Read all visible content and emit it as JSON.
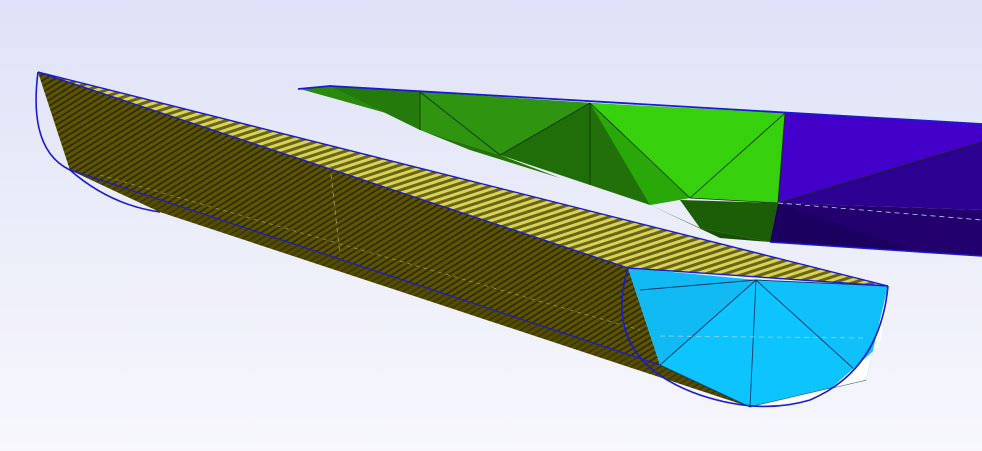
{
  "viewport": {
    "background_top": "#dfe2f8",
    "background_bottom": "#f7f7fd",
    "outline_color": "#1a1ad0"
  },
  "objects": [
    {
      "name": "dark-green-mesh-section",
      "color": "#237a0c"
    },
    {
      "name": "bright-green-mesh-section",
      "color": "#33cc0a"
    },
    {
      "name": "violet-mesh-section",
      "color": "#3d00c0"
    },
    {
      "name": "hatched-olive-half-cylinder",
      "color": "#5a5000",
      "hatch_color": "#d8d85a"
    },
    {
      "name": "cyan-end-cap",
      "color": "#0ec4ff"
    }
  ]
}
